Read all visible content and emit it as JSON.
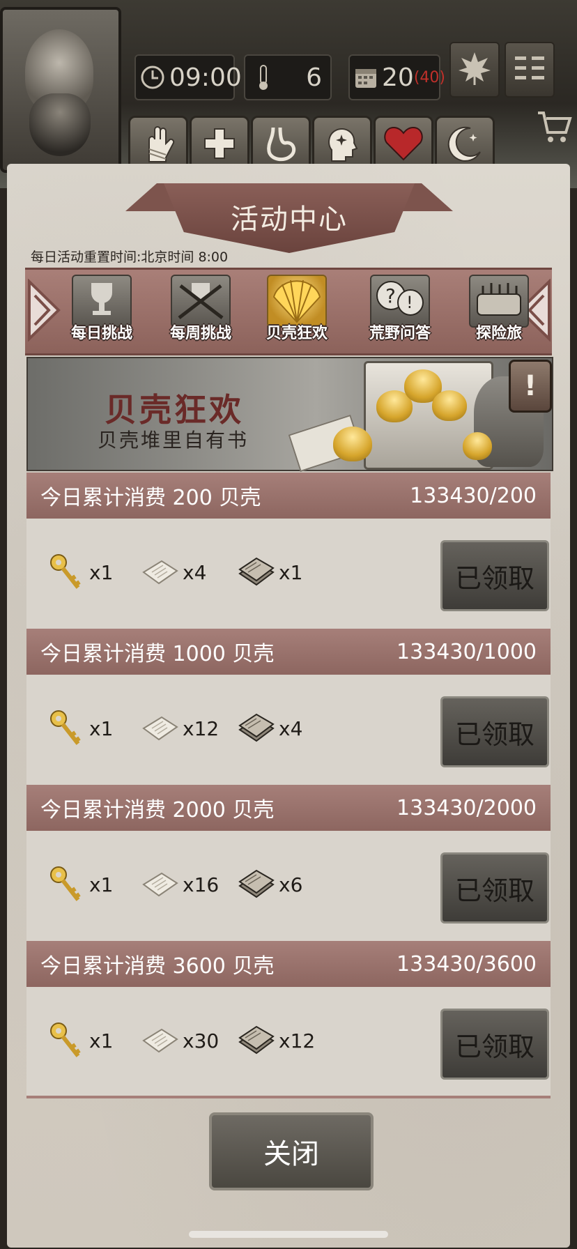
{
  "hud": {
    "time": "09:00",
    "temperature": "6",
    "day": "20",
    "day_max": "(40)"
  },
  "title": "活动中心",
  "reset_notice": "每日活动重置时间:北京时间 8:00",
  "tabs": [
    {
      "label": "每日挑战",
      "icon": "trophy-icon"
    },
    {
      "label": "每周挑战",
      "icon": "crossed-swords-trophy-icon"
    },
    {
      "label": "贝壳狂欢",
      "icon": "shell-icon",
      "active": true
    },
    {
      "label": "荒野问答",
      "icon": "question-bubbles-icon"
    },
    {
      "label": "探险旅",
      "icon": "expedition-icon"
    }
  ],
  "banner": {
    "title": "贝壳狂欢",
    "subtitle": "贝壳堆里自有书",
    "info_mark": "!"
  },
  "rewards": [
    {
      "title": "今日累计消费 200 贝壳",
      "progress": "133430/200",
      "items": [
        {
          "icon": "gold-key-icon",
          "qty": "x1"
        },
        {
          "icon": "paper-icon",
          "qty": "x4"
        },
        {
          "icon": "book-stack-icon",
          "qty": "x1"
        }
      ],
      "button": "已领取"
    },
    {
      "title": "今日累计消费 1000 贝壳",
      "progress": "133430/1000",
      "items": [
        {
          "icon": "gold-key-icon",
          "qty": "x1"
        },
        {
          "icon": "paper-icon",
          "qty": "x12"
        },
        {
          "icon": "book-stack-icon",
          "qty": "x4"
        }
      ],
      "button": "已领取"
    },
    {
      "title": "今日累计消费 2000 贝壳",
      "progress": "133430/2000",
      "items": [
        {
          "icon": "gold-key-icon",
          "qty": "x1"
        },
        {
          "icon": "paper-icon",
          "qty": "x16"
        },
        {
          "icon": "book-stack-icon",
          "qty": "x6"
        }
      ],
      "button": "已领取"
    },
    {
      "title": "今日累计消费 3600 贝壳",
      "progress": "133430/3600",
      "items": [
        {
          "icon": "gold-key-icon",
          "qty": "x1"
        },
        {
          "icon": "paper-icon",
          "qty": "x30"
        },
        {
          "icon": "book-stack-icon",
          "qty": "x12"
        }
      ],
      "button": "已领取"
    }
  ],
  "close_label": "关闭",
  "colors": {
    "accent": "#9a706a",
    "button_dark": "#4a4740",
    "day_max": "#c0302a"
  }
}
